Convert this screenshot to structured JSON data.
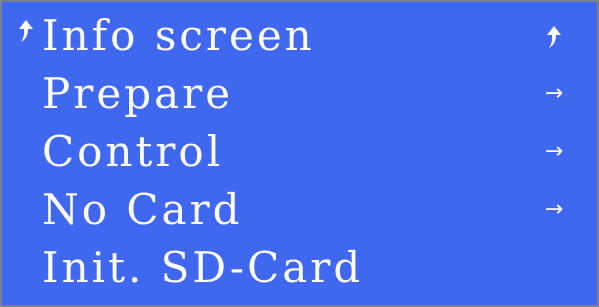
{
  "display": {
    "background_color": "#3f67ef",
    "text_color": "#ffffff"
  },
  "menu": {
    "items": [
      {
        "label": "Info screen",
        "prefix_icon": "back-arrow-icon",
        "suffix_icon": "back-arrow-icon",
        "selected": true
      },
      {
        "label": "Prepare",
        "suffix_icon": "right-arrow-icon"
      },
      {
        "label": "Control",
        "suffix_icon": "right-arrow-icon"
      },
      {
        "label": "No Card",
        "suffix_icon": "right-arrow-icon"
      },
      {
        "label": "Init. SD-Card"
      }
    ]
  }
}
